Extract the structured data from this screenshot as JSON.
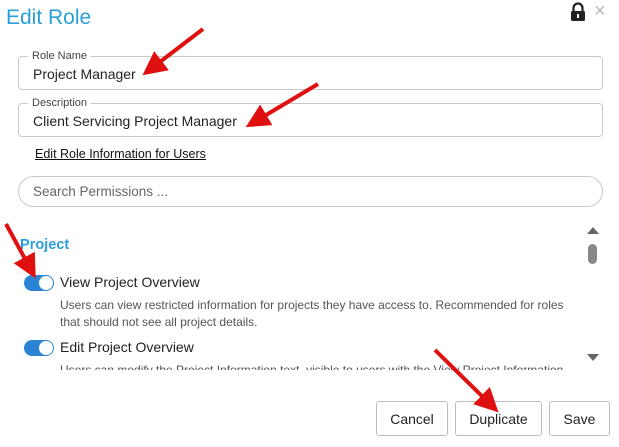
{
  "dialog": {
    "title": "Edit Role",
    "lock_icon": "lock-icon",
    "close_icon": "close-icon",
    "close_glyph": "×"
  },
  "role_name": {
    "legend": "Role Name",
    "value": "Project Manager"
  },
  "description": {
    "legend": "Description",
    "value": "Client Servicing Project Manager"
  },
  "edit_link": "Edit Role Information for Users",
  "search": {
    "placeholder": "Search Permissions ..."
  },
  "permissions": {
    "section": "Project",
    "items": [
      {
        "label": "View Project Overview",
        "enabled": true,
        "description": "Users can view restricted information for projects they have access to. Recommended for roles that should not see all project details."
      },
      {
        "label": "Edit Project Overview",
        "enabled": true,
        "description": "Users can modify the Project Information text, visible to users with the View Project Information"
      }
    ]
  },
  "buttons": {
    "cancel": "Cancel",
    "duplicate": "Duplicate",
    "save": "Save"
  },
  "colors": {
    "accent": "#2a9fd8",
    "toggle": "#2a84d6",
    "annotation_arrow": "#e01010"
  }
}
